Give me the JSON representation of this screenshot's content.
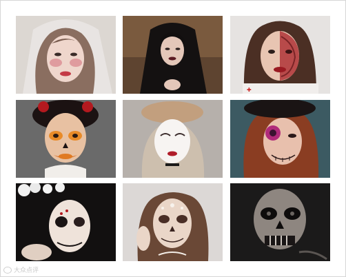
{
  "collage": {
    "watermark_logo_text": "大众点评",
    "tiles": [
      {
        "id": "t1",
        "icon": "bride-veil-blush-makeup-photo"
      },
      {
        "id": "t2",
        "icon": "black-veil-dark-lips-photo"
      },
      {
        "id": "t3",
        "icon": "half-face-wound-makeup-photo"
      },
      {
        "id": "t4",
        "icon": "pumpkin-clown-makeup-photo"
      },
      {
        "id": "t5",
        "icon": "beret-mime-makeup-photo"
      },
      {
        "id": "t6",
        "icon": "flower-eye-sugar-skull-photo"
      },
      {
        "id": "t7",
        "icon": "floral-crown-skull-makeup-photo"
      },
      {
        "id": "t8",
        "icon": "pearl-sugar-skull-makeup-photo"
      },
      {
        "id": "t9",
        "icon": "dark-skeleton-face-photo"
      }
    ]
  }
}
